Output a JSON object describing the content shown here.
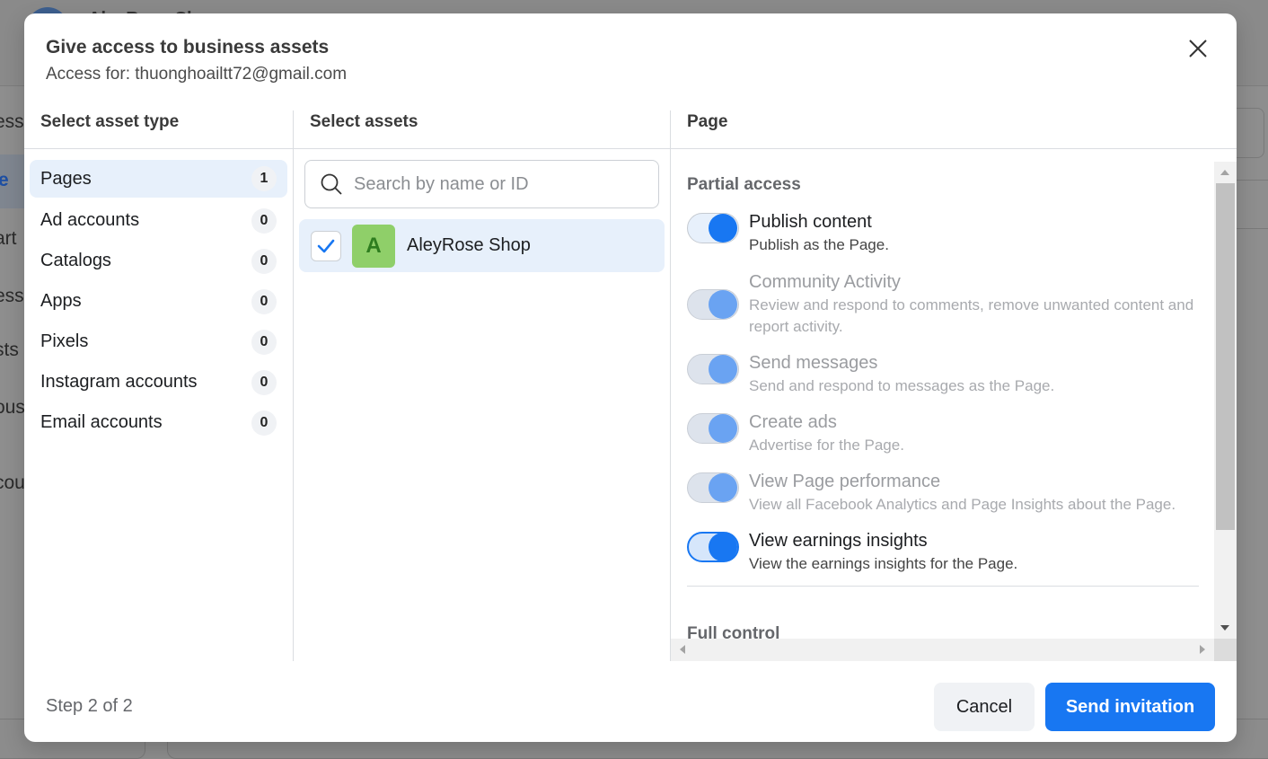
{
  "background": {
    "page_title_fragment": "AleyRose Shop",
    "sidebar_fragments": [
      "ess",
      "e",
      "art",
      "ess",
      "sts",
      "ous",
      "cou"
    ]
  },
  "modal": {
    "title": "Give access to business assets",
    "subtitle": "Access for: thuonghoailtt72@gmail.com",
    "close_icon": "close-icon"
  },
  "columns": {
    "asset_type_header": "Select asset type",
    "assets_header": "Select assets",
    "permissions_header": "Page"
  },
  "asset_types": [
    {
      "label": "Pages",
      "count": "1",
      "active": true
    },
    {
      "label": "Ad accounts",
      "count": "0",
      "active": false
    },
    {
      "label": "Catalogs",
      "count": "0",
      "active": false
    },
    {
      "label": "Apps",
      "count": "0",
      "active": false
    },
    {
      "label": "Pixels",
      "count": "0",
      "active": false
    },
    {
      "label": "Instagram accounts",
      "count": "0",
      "active": false
    },
    {
      "label": "Email accounts",
      "count": "0",
      "active": false
    }
  ],
  "search": {
    "placeholder": "Search by name or ID",
    "value": "",
    "icon": "search-icon"
  },
  "assets": [
    {
      "name": "AleyRose Shop",
      "avatar_letter": "A",
      "checked": true
    }
  ],
  "permissions": {
    "partial_title": "Partial access",
    "items": [
      {
        "label": "Publish content",
        "description": "Publish as the Page.",
        "enabled": true,
        "state": "on"
      },
      {
        "label": "Community Activity",
        "description": "Review and respond to comments, remove unwanted content and report activity.",
        "enabled": true,
        "state": "disabled"
      },
      {
        "label": "Send messages",
        "description": "Send and respond to messages as the Page.",
        "enabled": true,
        "state": "disabled"
      },
      {
        "label": "Create ads",
        "description": "Advertise for the Page.",
        "enabled": true,
        "state": "disabled"
      },
      {
        "label": "View Page performance",
        "description": "View all Facebook Analytics and Page Insights about the Page.",
        "enabled": true,
        "state": "disabled"
      },
      {
        "label": "View earnings insights",
        "description": "View the earnings insights for the Page.",
        "enabled": true,
        "state": "focus"
      }
    ],
    "full_title": "Full control"
  },
  "footer": {
    "step": "Step 2 of 2",
    "cancel_label": "Cancel",
    "send_label": "Send invitation"
  },
  "colors": {
    "primary": "#1877f2",
    "selected_bg": "#e7f0fb",
    "avatar_bg": "#8fcf69"
  }
}
